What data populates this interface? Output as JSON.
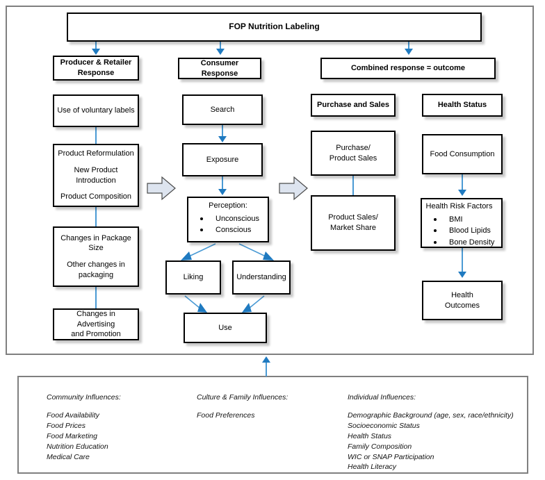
{
  "diagram": {
    "title_box": {
      "label": "FOP Nutrition Labeling"
    },
    "colors": {
      "connector_blue": "#4a9ad4",
      "arrow_blue": "#1f7ac0",
      "block_arrow_fill": "#dde4ef",
      "box_border": "#000000",
      "frame_border": "#7f7f7f"
    },
    "columns": [
      {
        "id": "producer",
        "header": "Producer & Retailer Response",
        "nodes": [
          {
            "id": "voluntary-labels",
            "lines": [
              "Use of voluntary labels"
            ]
          },
          {
            "id": "product-reformulation",
            "lines": [
              "Product Reformulation",
              "",
              "New Product",
              "Introduction",
              "",
              "Product Composition"
            ]
          },
          {
            "id": "package-changes",
            "lines": [
              "Changes in Package",
              "Size",
              "",
              "Other changes in",
              "packaging"
            ]
          },
          {
            "id": "advertising-changes",
            "lines": [
              "Changes in Advertising",
              "and Promotion"
            ]
          }
        ]
      },
      {
        "id": "consumer",
        "header": "Consumer Response",
        "nodes": [
          {
            "id": "search",
            "lines": [
              "Search"
            ]
          },
          {
            "id": "exposure",
            "lines": [
              "Exposure"
            ]
          },
          {
            "id": "perception",
            "lines": [
              "Perception:"
            ],
            "bullets": [
              "Unconscious",
              "Conscious"
            ]
          },
          {
            "id": "liking",
            "lines": [
              "Liking"
            ]
          },
          {
            "id": "understanding",
            "lines": [
              "Understanding"
            ]
          },
          {
            "id": "use",
            "lines": [
              "Use"
            ]
          }
        ]
      },
      {
        "id": "combined",
        "header": "Combined response = outcome",
        "subcolumns": [
          {
            "id": "purchase-and-sales",
            "header": "Purchase and Sales",
            "nodes": [
              {
                "id": "purchase-product-sales",
                "lines": [
                  "Purchase/",
                  "Product Sales"
                ]
              },
              {
                "id": "product-sales-market-share",
                "lines": [
                  "Product Sales/",
                  "Market Share"
                ]
              }
            ]
          },
          {
            "id": "health-status",
            "header": "Health Status",
            "nodes": [
              {
                "id": "food-consumption",
                "lines": [
                  "Food Consumption"
                ]
              },
              {
                "id": "health-risk-factors",
                "lines": [
                  "Health Risk Factors"
                ],
                "bullets": [
                  "BMI",
                  "Blood   Lipids",
                  "Bone Density"
                ]
              },
              {
                "id": "health-outcomes",
                "lines": [
                  "Health",
                  "Outcomes"
                ]
              }
            ]
          }
        ]
      }
    ],
    "influences": [
      {
        "id": "community",
        "title": "Community Influences:",
        "items": [
          "Food Availability",
          "Food Prices",
          "Food Marketing",
          "Nutrition Education",
          "Medical Care"
        ]
      },
      {
        "id": "culture-family",
        "title": "Culture & Family Influences:",
        "items": [
          "Food Preferences"
        ]
      },
      {
        "id": "individual",
        "title": "Individual Influences:",
        "items": [
          "Demographic Background (age, sex, race/ethnicity)",
          "Socioeconomic Status",
          "Health Status",
          "Family Composition",
          "WIC or SNAP Participation",
          "Health Literacy"
        ]
      }
    ]
  }
}
